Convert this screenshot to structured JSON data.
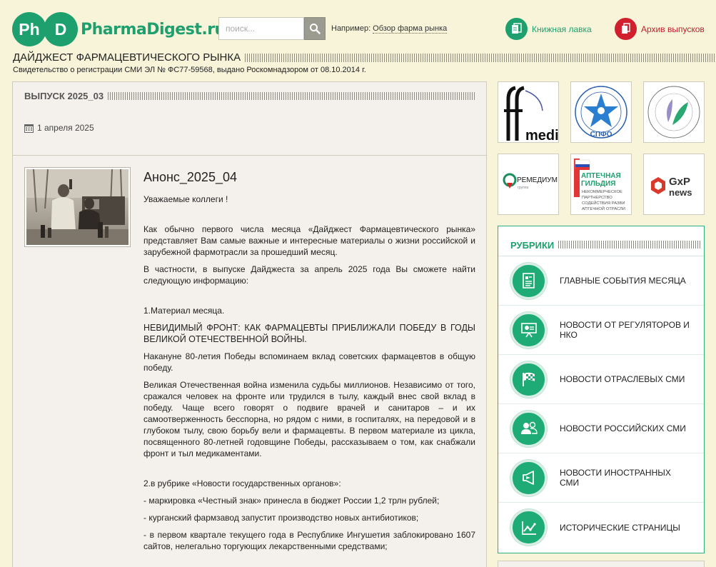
{
  "header": {
    "logo_letters_1": "Ph",
    "logo_letters_2": "D",
    "logo_text": "PharmaDigest.ru",
    "search_placeholder": "поиск...",
    "example_label": "Например:",
    "example_link": "Обзор фарма рынка",
    "books_label": "Книжная лавка",
    "archive_label": "Архив выпусков",
    "colors": {
      "brand": "#1e9f6e",
      "archive": "#d21f2d"
    }
  },
  "site": {
    "title": "ДАЙДЖЕСТ ФАРМАЦЕВТИЧЕСКОГО РЫНКА",
    "registration": "Свидетельство о регистрации СМИ ЭЛ № ФС77-59568, выдано Роскомнадзором от 08.10.2014 г."
  },
  "issue": {
    "title": "ВЫПУСК 2025_03",
    "date": "1 апреля 2025"
  },
  "article": {
    "title": "Анонс_2025_04",
    "greeting": "Уважаемые коллеги !",
    "p1": "Как обычно первого числа месяца «Дайджест Фармацевтического рынка» представляет Вам самые важные и интересные материалы о жизни российской и зарубежной фармотрасли за прошедший месяц.",
    "p2": "В частности, в выпуске Дайджеста за апрель 2025 года Вы сможете найти следующую информацию:",
    "p3": "1.Материал месяца.",
    "p4": "НЕВИДИМЫЙ ФРОНТ: КАК ФАРМАЦЕВТЫ ПРИБЛИЖАЛИ ПОБЕДУ В ГОДЫ ВЕЛИКОЙ ОТЕЧЕСТВЕННОЙ ВОЙНЫ.",
    "p5": "Накануне 80-летия Победы вспоминаем вклад советских фармацевтов в общую победу.",
    "p6": "Великая Отечественная война изменила судьбы миллионов. Независимо от того, сражался человек на фронте или трудился в тылу, каждый внес свой вклад в победу. Чаще всего говорят о подвиге врачей и санитаров – и их самоотверженность бесспорна, но рядом с ними, в госпиталях, на передовой и в глубоком тылу, свою борьбу вели и фармацевты. В первом материале из цикла, посвященного 80-летней годовщине Победы, рассказываем о том, как снабжали фронт и тыл медикаментами.",
    "p7": "2.в рубрике «Новости государственных органов»:",
    "p8": "- маркировка «Честный знак» принесла в бюджет России 1,2 трлн рублей;",
    "p9": "- курганский фармзавод запустит производство новых антибиотиков;",
    "p10": "- в первом квартале текущего года в Республике Ингушетия заблокировано 1607 сайтов, нелегально торгующих лекарственными средствами;"
  },
  "partners": {
    "ffmedia_text": "media",
    "spfo_text": "СПФО",
    "remedium_text": "РЕМЕДИУМ",
    "remedium_sub": "группа",
    "guild_title_1": "АПТЕЧНАЯ",
    "guild_title_2": "ГИЛЬДИЯ",
    "guild_sub_1": "НЕКОММЕРЧЕСКОЕ",
    "guild_sub_2": "ПАРТНЕРСТВО",
    "guild_sub_3": "СОДЕЙСТВИЯ РАЗВИ",
    "guild_sub_4": "АПТЕЧНОЙ ОТРАСЛИ",
    "gxp_1": "GxP",
    "gxp_2": "news"
  },
  "rubrics": {
    "title": "РУБРИКИ",
    "items": [
      {
        "label": "ГЛАВНЫЕ СОБЫТИЯ МЕСЯЦА",
        "icon": "document-icon"
      },
      {
        "label": "НОВОСТИ ОТ РЕГУЛЯТОРОВ И НКО",
        "icon": "presentation-icon"
      },
      {
        "label": "НОВОСТИ ОТРАСЛЕВЫХ СМИ",
        "icon": "flag-icon"
      },
      {
        "label": "НОВОСТИ РОССИЙСКИХ СМИ",
        "icon": "users-icon"
      },
      {
        "label": "НОВОСТИ ИНОСТРАННЫХ СМИ",
        "icon": "megaphone-icon"
      },
      {
        "label": "ИСТОРИЧЕСКИЕ СТРАНИЦЫ",
        "icon": "chart-icon"
      }
    ]
  }
}
